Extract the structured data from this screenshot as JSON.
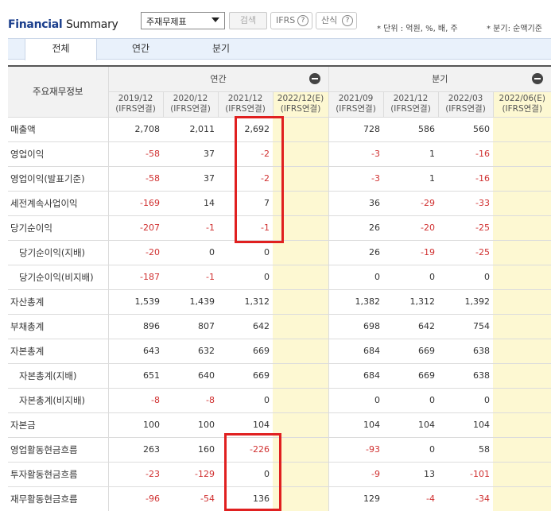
{
  "header": {
    "title_part1": "Financial",
    "title_part2": "Summary",
    "statement_select": "주재무제표",
    "search_button": "검색",
    "ifrs_button": "IFRS",
    "formula_button": "산식",
    "help_glyph": "?",
    "unit_note": "* 단위 : 억원, %, 배, 주",
    "quarter_note": "* 분기: 순액기준"
  },
  "tabs": [
    {
      "label": "전체",
      "active": true
    },
    {
      "label": "연간",
      "active": false
    },
    {
      "label": "분기",
      "active": false
    }
  ],
  "table": {
    "corner_label": "주요재무정보",
    "group_annual": "연간",
    "group_quarter": "분기",
    "columns": [
      {
        "period": "2019/12",
        "basis": "(IFRS연결)",
        "estimate": false
      },
      {
        "period": "2020/12",
        "basis": "(IFRS연결)",
        "estimate": false
      },
      {
        "period": "2021/12",
        "basis": "(IFRS연결)",
        "estimate": false
      },
      {
        "period": "2022/12(E)",
        "basis": "(IFRS연결)",
        "estimate": true
      },
      {
        "period": "2021/09",
        "basis": "(IFRS연결)",
        "estimate": false
      },
      {
        "period": "2021/12",
        "basis": "(IFRS연결)",
        "estimate": false
      },
      {
        "period": "2022/03",
        "basis": "(IFRS연결)",
        "estimate": false
      },
      {
        "period": "2022/06(E)",
        "basis": "(IFRS연결)",
        "estimate": true
      }
    ],
    "rows": [
      {
        "label": "매출액",
        "sub": false,
        "values": [
          "2,708",
          "2,011",
          "2,692",
          "",
          "728",
          "586",
          "560",
          ""
        ]
      },
      {
        "label": "영업이익",
        "sub": false,
        "values": [
          "-58",
          "37",
          "-2",
          "",
          "-3",
          "1",
          "-16",
          ""
        ]
      },
      {
        "label": "영업이익(발표기준)",
        "sub": false,
        "values": [
          "-58",
          "37",
          "-2",
          "",
          "-3",
          "1",
          "-16",
          ""
        ]
      },
      {
        "label": "세전계속사업이익",
        "sub": false,
        "values": [
          "-169",
          "14",
          "7",
          "",
          "36",
          "-29",
          "-33",
          ""
        ]
      },
      {
        "label": "당기순이익",
        "sub": false,
        "values": [
          "-207",
          "-1",
          "-1",
          "",
          "26",
          "-20",
          "-25",
          ""
        ]
      },
      {
        "label": "당기순이익(지배)",
        "sub": true,
        "values": [
          "-20",
          "0",
          "0",
          "",
          "26",
          "-19",
          "-25",
          ""
        ]
      },
      {
        "label": "당기순이익(비지배)",
        "sub": true,
        "values": [
          "-187",
          "-1",
          "0",
          "",
          "0",
          "0",
          "0",
          ""
        ]
      },
      {
        "label": "자산총계",
        "sub": false,
        "values": [
          "1,539",
          "1,439",
          "1,312",
          "",
          "1,382",
          "1,312",
          "1,392",
          ""
        ]
      },
      {
        "label": "부채총계",
        "sub": false,
        "values": [
          "896",
          "807",
          "642",
          "",
          "698",
          "642",
          "754",
          ""
        ]
      },
      {
        "label": "자본총계",
        "sub": false,
        "values": [
          "643",
          "632",
          "669",
          "",
          "684",
          "669",
          "638",
          ""
        ]
      },
      {
        "label": "자본총계(지배)",
        "sub": true,
        "values": [
          "651",
          "640",
          "669",
          "",
          "684",
          "669",
          "638",
          ""
        ]
      },
      {
        "label": "자본총계(비지배)",
        "sub": true,
        "values": [
          "-8",
          "-8",
          "0",
          "",
          "0",
          "0",
          "0",
          ""
        ]
      },
      {
        "label": "자본금",
        "sub": false,
        "values": [
          "100",
          "100",
          "104",
          "",
          "104",
          "104",
          "104",
          ""
        ]
      },
      {
        "label": "영업활동현금흐름",
        "sub": false,
        "values": [
          "263",
          "160",
          "-226",
          "",
          "-93",
          "0",
          "58",
          ""
        ]
      },
      {
        "label": "투자활동현금흐름",
        "sub": false,
        "values": [
          "-23",
          "-129",
          "0",
          "",
          "-9",
          "13",
          "-101",
          ""
        ]
      },
      {
        "label": "재무활동현금흐름",
        "sub": false,
        "values": [
          "-96",
          "-54",
          "136",
          "",
          "129",
          "-4",
          "-34",
          ""
        ]
      }
    ]
  },
  "colors": {
    "negative": "#d03030",
    "estimate_bg": "#fdf8d2",
    "highlight_box": "#e02020",
    "title_blue": "#1a3e8c"
  }
}
